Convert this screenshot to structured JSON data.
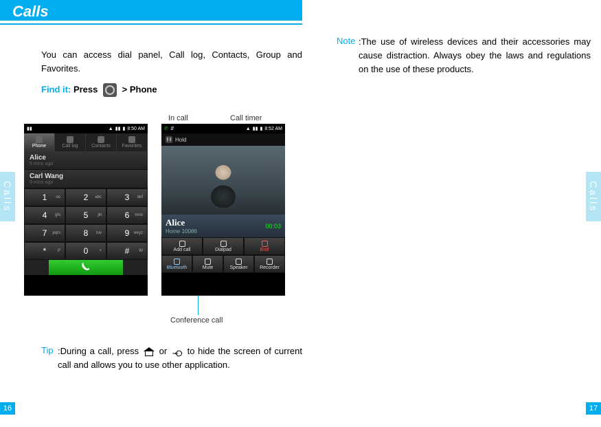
{
  "header": {
    "title": "Calls"
  },
  "side_tabs": {
    "left": "Calls",
    "right": "Calls"
  },
  "pages": {
    "left": "16",
    "right": "17"
  },
  "intro": "You can access dial panel, Call log, Contacts, Group and Favorites.",
  "find_it": {
    "label": "Find it:",
    "press": "Press",
    "suffix": "> Phone"
  },
  "annotations": {
    "in_call": "In call",
    "call_timer": "Call timer",
    "conference": "Conference call"
  },
  "phone_left": {
    "status_time": "8:50 AM",
    "tabs": [
      "Phone",
      "Call log",
      "Contacts",
      "Favorites"
    ],
    "recents": [
      {
        "name": "Alice",
        "time": "5 mins ago"
      },
      {
        "name": "Carl Wang",
        "time": "9 mins ago"
      }
    ],
    "keys": [
      {
        "d": "1",
        "s": "oo"
      },
      {
        "d": "2",
        "s": "abc"
      },
      {
        "d": "3",
        "s": "def"
      },
      {
        "d": "4",
        "s": "ghi"
      },
      {
        "d": "5",
        "s": "jkl"
      },
      {
        "d": "6",
        "s": "mno"
      },
      {
        "d": "7",
        "s": "pqrs"
      },
      {
        "d": "8",
        "s": "tuv"
      },
      {
        "d": "9",
        "s": "wxyz"
      },
      {
        "d": "*",
        "s": "P"
      },
      {
        "d": "0",
        "s": "+"
      },
      {
        "d": "#",
        "s": "W"
      }
    ]
  },
  "phone_right": {
    "status_time": "8:52 AM",
    "hold": "Hold",
    "caller_name": "Alice",
    "caller_sub": "Home 10086",
    "timer": "00:03",
    "row1": [
      "Add call",
      "Dialpad",
      "End"
    ],
    "row2": [
      "Bluetooth",
      "Mute",
      "Speaker",
      "Recorder"
    ]
  },
  "tip": {
    "label": "Tip",
    "text": ":During a call, press          or          to hide the screen of current call and allows you to use other application.",
    "text_a": ":During a call, press ",
    "text_b": " or ",
    "text_c": " to hide the screen of current call and allows you to use other application."
  },
  "note": {
    "label": "Note",
    "text": ":The use of wireless devices and their accessories may cause distraction. Always obey the laws and regulations on the use of these products."
  }
}
